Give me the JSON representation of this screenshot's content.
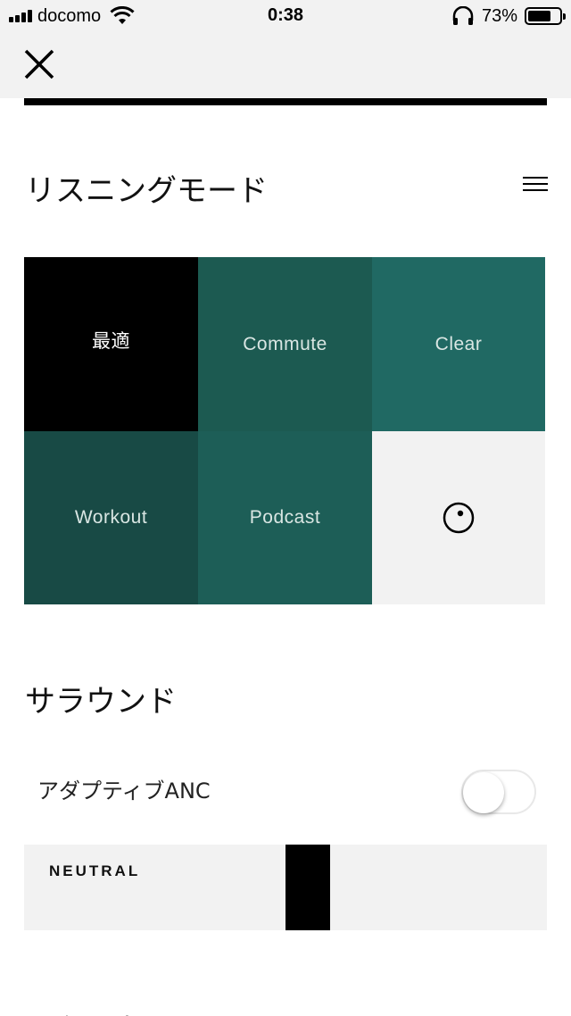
{
  "status_bar": {
    "carrier": "docomo",
    "time": "0:38",
    "battery_percent": "73%",
    "battery_level": 0.73
  },
  "header": {
    "close_icon": "close-icon"
  },
  "listening_mode": {
    "title": "リスニングモード",
    "modes": [
      {
        "label": "最適",
        "color": "#000000",
        "selected": true
      },
      {
        "label": "Commute",
        "color": "#1c5a51"
      },
      {
        "label": "Clear",
        "color": "#206963"
      },
      {
        "label": "Workout",
        "color": "#184a45"
      },
      {
        "label": "Podcast",
        "color": "#1d5e57"
      },
      {
        "icon": "target-add-icon",
        "color": "#f2f2f2"
      }
    ]
  },
  "surround": {
    "title": "サラウンド",
    "anc_label": "アダプティブANC",
    "anc_enabled": false,
    "slider_label": "NEUTRAL",
    "slider_value": 0.5
  },
  "next_section": {
    "title": "イ 組間土"
  }
}
